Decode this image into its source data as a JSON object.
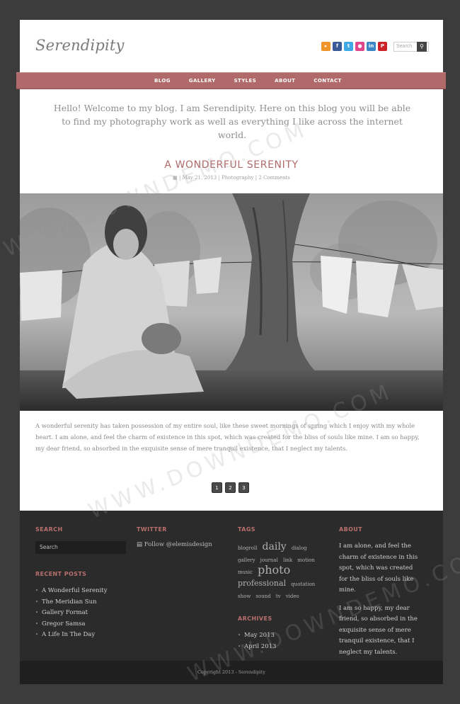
{
  "site": {
    "logo": "Serendipity"
  },
  "header": {
    "social_icons": [
      {
        "name": "rss-icon",
        "glyph": "▸",
        "color": "#f0952a"
      },
      {
        "name": "facebook-icon",
        "glyph": "f",
        "color": "#3b5998"
      },
      {
        "name": "twitter-icon",
        "glyph": "t",
        "color": "#3fa9e6"
      },
      {
        "name": "dribbble-icon",
        "glyph": "●",
        "color": "#e0478a"
      },
      {
        "name": "linkedin-icon",
        "glyph": "in",
        "color": "#3a86c6"
      },
      {
        "name": "pinterest-icon",
        "glyph": "P",
        "color": "#cc2127"
      }
    ],
    "search_placeholder": "Search"
  },
  "nav": {
    "items": [
      "BLOG",
      "GALLERY",
      "STYLES",
      "ABOUT",
      "CONTACT"
    ]
  },
  "intro": "Hello! Welcome to my blog. I am Serendipity. Here on this blog you will be able to find my photography work as well as everything I like across the internet world.",
  "post": {
    "title": "A WONDERFUL SERENITY",
    "date": "May 21, 2013",
    "category": "Photography",
    "comments": "2 Comments",
    "body": "A wonderful serenity has taken possession of my entire soul, like these sweet mornings of spring which I enjoy with my whole heart. I am alone, and feel the charm of existence in this spot, which was created for the bliss of souls like mine. I am so happy, my dear friend, so absorbed in the exquisite sense of mere tranquil existence, that I neglect my talents."
  },
  "pagination": [
    "1",
    "2",
    "3"
  ],
  "footer": {
    "search": {
      "heading": "SEARCH",
      "placeholder": "Search"
    },
    "recent": {
      "heading": "RECENT POSTS",
      "items": [
        "A Wonderful Serenity",
        "The Meridian Sun",
        "Gallery Format",
        "Gregor Samsa",
        "A Life In The Day"
      ]
    },
    "twitter": {
      "heading": "TWITTER",
      "text": "Follow @elemisdesign"
    },
    "tags": {
      "heading": "TAGS",
      "items": [
        {
          "t": "blogroll",
          "s": 7
        },
        {
          "t": "daily",
          "s": 14
        },
        {
          "t": "dialog",
          "s": 7
        },
        {
          "t": "gallery",
          "s": 7
        },
        {
          "t": "journal",
          "s": 7
        },
        {
          "t": "link",
          "s": 7
        },
        {
          "t": "motion",
          "s": 7
        },
        {
          "t": "music",
          "s": 7
        },
        {
          "t": "photo",
          "s": 16
        },
        {
          "t": "professional",
          "s": 11
        },
        {
          "t": "quotation",
          "s": 7
        },
        {
          "t": "show",
          "s": 7
        },
        {
          "t": "sound",
          "s": 7
        },
        {
          "t": "tv",
          "s": 7
        },
        {
          "t": "video",
          "s": 7
        }
      ]
    },
    "archives": {
      "heading": "ARCHIVES",
      "items": [
        "May 2013",
        "April 2013"
      ]
    },
    "about": {
      "heading": "ABOUT",
      "p1": "I am alone, and feel the charm of existence in this spot, which was created for the bliss of souls like mine.",
      "p2": "I am so happy, my dear friend, so absorbed in the exquisite sense of mere tranquil existence, that I neglect my talents."
    },
    "copyright": "Copyright 2013 - Serendipity"
  },
  "watermark": "WWW.DOWNDEMO.COM"
}
